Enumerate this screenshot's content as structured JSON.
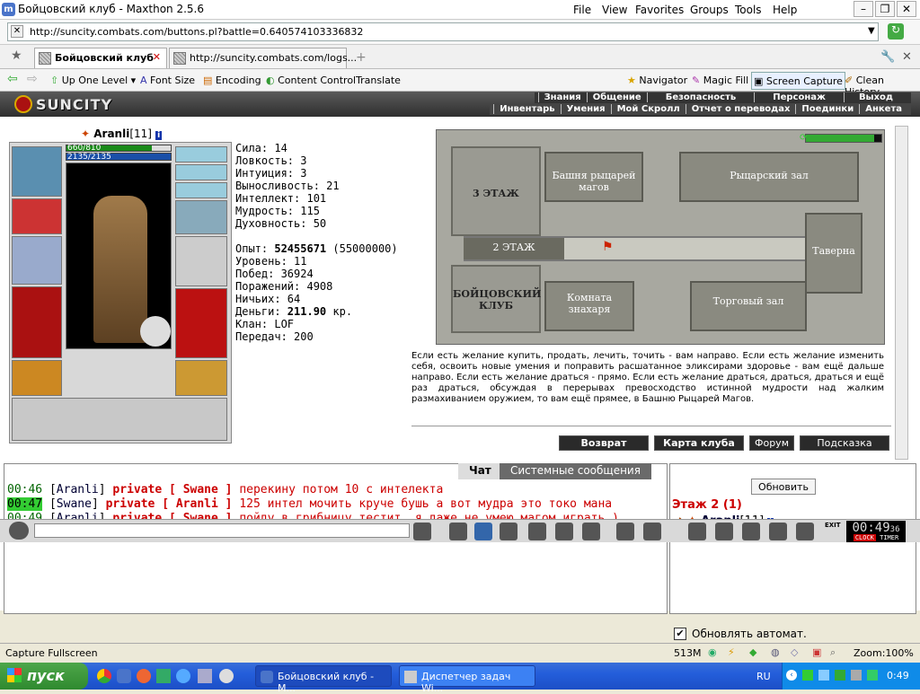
{
  "window": {
    "title": "Бойцовский клуб - Maxthon 2.5.6",
    "menus": [
      "File",
      "View",
      "Favorites",
      "Groups",
      "Tools",
      "Help"
    ],
    "controls": [
      "–",
      "❐",
      "✕"
    ]
  },
  "address": {
    "url": "http://suncity.combats.com/buttons.pl?battle=0.640574103336832"
  },
  "tabs": [
    {
      "label": "Бойцовский клуб",
      "active": true
    },
    {
      "label": "http://suncity.combats.com/logs...",
      "active": false
    }
  ],
  "toolbar": {
    "up_level": "Up One Level",
    "font_size": "Font Size",
    "encoding": "Encoding",
    "content_control": "Content Control",
    "translate": "Translate",
    "navigator": "Navigator",
    "magic_fill": "Magic Fill",
    "screen_capture": "Screen Capture",
    "clean_history": "Clean History"
  },
  "game": {
    "logo": "SUNCITY",
    "nav_top": [
      "Знания",
      "Общение",
      "Безопасность",
      "Персонаж",
      "Выход"
    ],
    "nav_bottom": [
      "Инвентарь",
      "Умения",
      "Мой Скролл",
      "Отчет о переводах",
      "Поединки",
      "Анкета"
    ],
    "character": {
      "name": "Aranli",
      "level": "[11]",
      "hp": "660/810",
      "mana": "2135/2135",
      "hp_fraction": 0.815,
      "mana_fraction": 1.0
    },
    "stats": [
      {
        "label": "Сила: ",
        "value": "14"
      },
      {
        "label": "Ловкость: ",
        "value": "3"
      },
      {
        "label": "Интуиция: ",
        "value": "3"
      },
      {
        "label": "Выносливость: ",
        "value": "21"
      },
      {
        "label": "Интеллект: ",
        "value": "101"
      },
      {
        "label": "Мудрость: ",
        "value": "115"
      },
      {
        "label": "Духовность: ",
        "value": "50"
      }
    ],
    "info": {
      "exp_label": "Опыт: ",
      "exp": "52455671",
      "exp_next": " (55000000)",
      "level": "Уровень: 11",
      "wins": "Побед: 36924",
      "losses": "Поражений: 4908",
      "draws": "Ничьих: 64",
      "money_label": "Деньги: ",
      "money": "211.90",
      "money_unit": " кр.",
      "clan": "Клан: LOF",
      "transfers": "Передач: 200"
    },
    "map": {
      "floor3": "3 ЭТАЖ",
      "floor2": "2 ЭТАЖ",
      "club": "БОЙЦОВСКИЙ КЛУБ",
      "mage_tower": "Башня рыцарей магов",
      "knight_hall": "Рыцарский зал",
      "tavern": "Таверна",
      "healer": "Комната знахаря",
      "trade_hall": "Торговый зал"
    },
    "description": "Если есть желание купить, продать, лечить, точить - вам направо. Если есть желание изменить себя, освоить новые умения и поправить расшатанное эликсирами здоровье - вам ещё дальше направо. Если есть желание драться - прямо. Если есть желание драться, драться, драться и ещё раз драться, обсуждая в перерывах превосходство истинной мудрости над жалким размахиванием оружием, то вам ещё прямее, в Башню Рыцарей Магов.",
    "buttons": {
      "back": "Возврат",
      "club_map": "Карта клуба",
      "forum": "Форум",
      "hint": "Подсказка"
    }
  },
  "chat": {
    "tabs": {
      "chat": "Чат",
      "system": "Системные сообщения"
    },
    "messages": [
      {
        "time": "00:46",
        "highlight": false,
        "nick": "Aranli",
        "priv": "private [ Swane ]",
        "text": "перекину потом 10 с интелекта"
      },
      {
        "time": "00:47",
        "highlight": true,
        "nick": "Swane",
        "priv": "private [ Aranli ]",
        "text": "125 интел мочить круче бушь а вот мудра это токо мана"
      },
      {
        "time": "00:49",
        "highlight": false,
        "nick": "Aranli",
        "priv": "private [ Swane ]",
        "text": "пойду в грибницу тестит. я даже не умею магом играть )"
      }
    ]
  },
  "side": {
    "refresh": "Обновить",
    "floor": "Этаж 2 (1)",
    "user": "Aranli",
    "user_level": "[11]",
    "auto_label": "Обновлять автомат."
  },
  "clock": {
    "time": "00:49",
    "sec": "36",
    "clock_label": "CLOCK",
    "timer_label": "TIMER",
    "exit": "EXIT"
  },
  "status": {
    "capture": "Capture Fullscreen",
    "memory": "513M",
    "zoom": "Zoom:100%"
  },
  "taskbar": {
    "start": "пуск",
    "tasks": [
      "Бойцовский клуб - М...",
      "Диспетчер задач Wi..."
    ],
    "lang": "RU",
    "time": "0:49"
  }
}
